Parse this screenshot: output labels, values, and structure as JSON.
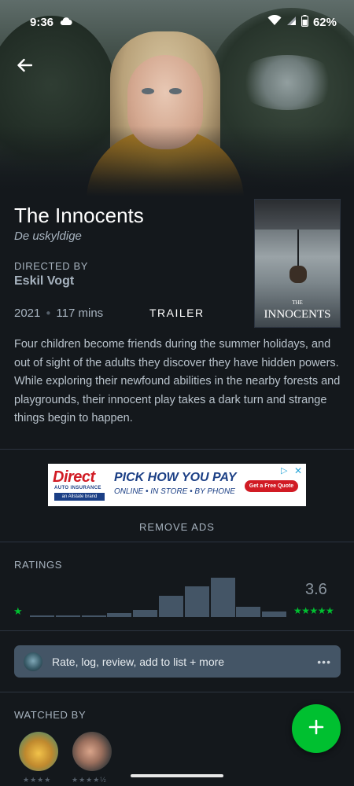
{
  "status_bar": {
    "time": "9:36",
    "battery": "62%"
  },
  "film": {
    "title": "The Innocents",
    "original_title": "De uskyldige",
    "directed_by_label": "DIRECTED BY",
    "director": "Eskil Vogt",
    "year": "2021",
    "runtime": "117 mins",
    "trailer_label": "TRAILER",
    "poster_the": "THE",
    "poster_title": "INNOCENTS",
    "synopsis": "Four children become friends during the summer holidays, and out of sight of the adults they discover they have hidden powers. While exploring their newfound abilities in the nearby forests and playgrounds, their innocent play takes a dark turn and strange things begin to happen."
  },
  "ad": {
    "brand": "Direct",
    "brand_sub": "AUTO INSURANCE",
    "brand_tag": "an Allstate brand",
    "headline": "PICK HOW YOU PAY",
    "subline": "ONLINE • IN STORE • BY PHONE",
    "cta": "Get a Free Quote"
  },
  "remove_ads_label": "REMOVE ADS",
  "ratings": {
    "label": "RATINGS",
    "average": "3.6",
    "histogram": [
      0.02,
      0.02,
      0.02,
      0.1,
      0.18,
      0.54,
      0.78,
      1.0,
      0.25,
      0.14
    ]
  },
  "action_bar": {
    "label": "Rate, log, review, add to list + more",
    "more": "•••"
  },
  "watched_by": {
    "label": "WATCHED BY",
    "friends": [
      {
        "stars": "★★★★"
      },
      {
        "stars": "★★★★½"
      }
    ]
  },
  "colors": {
    "accent_green": "#00c030",
    "background": "#14181c",
    "bar": "#445566"
  },
  "icons": {
    "back": "arrow-left-icon",
    "fab": "plus-icon"
  }
}
